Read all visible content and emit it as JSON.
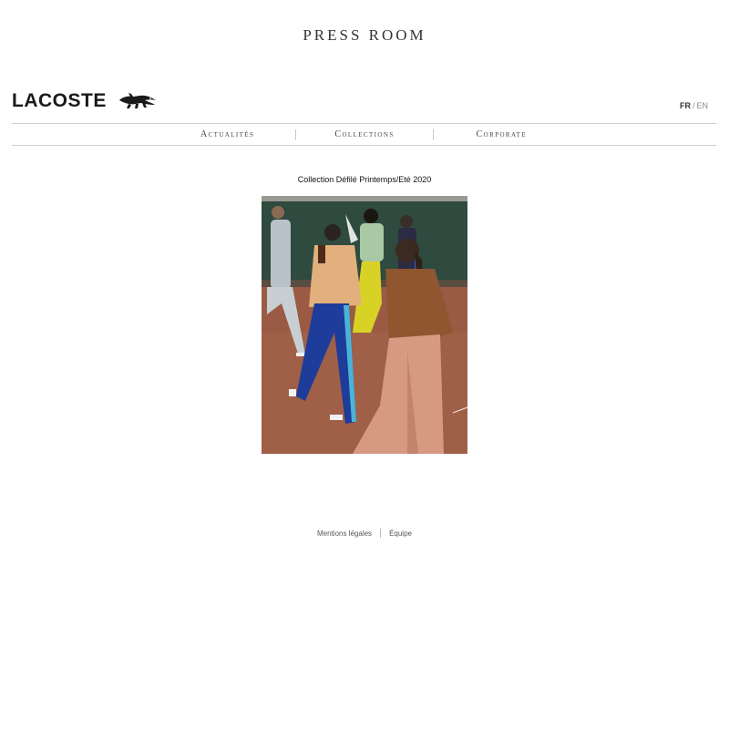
{
  "header": {
    "title": "PRESS ROOM"
  },
  "brand": {
    "name": "LACOSTE"
  },
  "language": {
    "fr": "FR",
    "separator": "/",
    "en": "EN"
  },
  "nav": {
    "items": [
      "Actualités",
      "Collections",
      "Corporate"
    ]
  },
  "main": {
    "caption": "Collection Défilé Printemps/Eté 2020"
  },
  "footer": {
    "links": [
      "Mentions légales",
      "Équipe"
    ]
  },
  "colors": {
    "rule": "#cfcfcf",
    "text": "#222222",
    "muted": "#888888"
  },
  "icons": {
    "brand_mark": "crocodile-logo-icon"
  }
}
